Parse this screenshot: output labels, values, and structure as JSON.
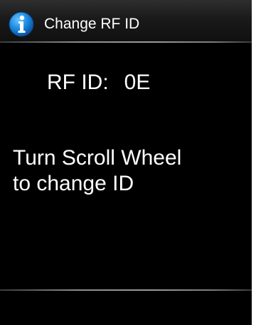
{
  "header": {
    "icon": "info-icon",
    "title": "Change RF ID"
  },
  "rfid": {
    "label": "RF ID:",
    "value": "0E"
  },
  "instruction": {
    "line1": "Turn Scroll Wheel",
    "line2": "to change ID"
  },
  "colors": {
    "background": "#000000",
    "text": "#ffffff",
    "info_icon": "#1a8ae0"
  }
}
